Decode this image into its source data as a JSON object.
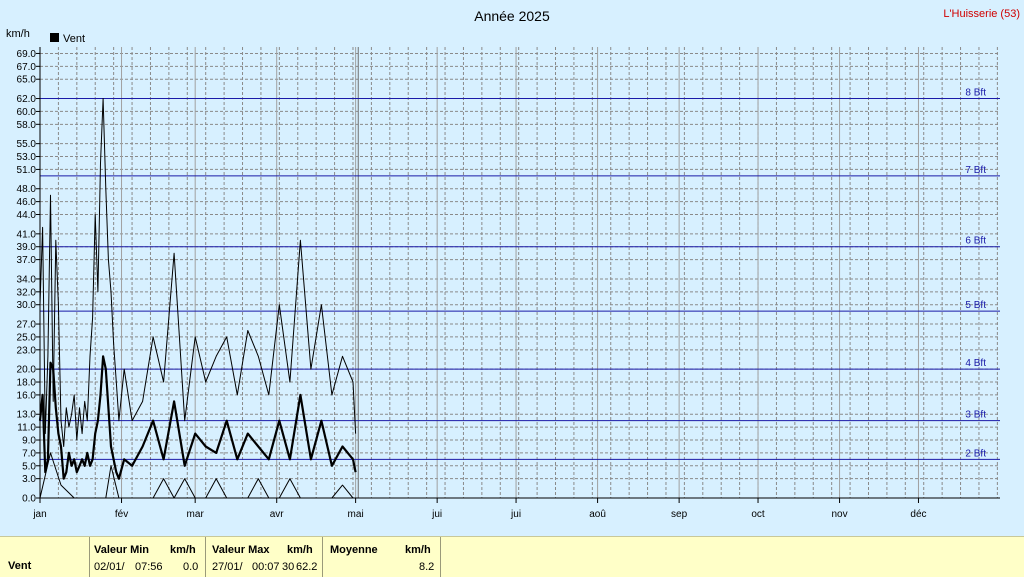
{
  "chart_data": {
    "type": "line",
    "title": "Année 2025",
    "station": "L'Huisserie (53)",
    "ylabel": "km/h",
    "ylim": [
      0,
      70
    ],
    "yticks": [
      "0.0",
      "3.0",
      "5.0",
      "7.0",
      "9.0",
      "11.0",
      "13.0",
      "16.0",
      "18.0",
      "20.0",
      "23.0",
      "25.0",
      "27.0",
      "30.0",
      "32.0",
      "34.0",
      "37.0",
      "39.0",
      "41.0",
      "44.0",
      "46.0",
      "48.0",
      "51.0",
      "53.0",
      "55.0",
      "58.0",
      "60.0",
      "62.0",
      "65.0",
      "67.0",
      "69.0"
    ],
    "months": [
      "jan",
      "fév",
      "mar",
      "avr",
      "mai",
      "jui",
      "jui",
      "aoû",
      "sep",
      "oct",
      "nov",
      "déc"
    ],
    "legend": [
      {
        "name": "Vent",
        "color": "#000000"
      }
    ],
    "grid": true,
    "beaufort": [
      {
        "label": "2 Bft",
        "value": 6
      },
      {
        "label": "3 Bft",
        "value": 12
      },
      {
        "label": "4 Bft",
        "value": 20
      },
      {
        "label": "5 Bft",
        "value": 29
      },
      {
        "label": "6 Bft",
        "value": 39
      },
      {
        "label": "7 Bft",
        "value": 50
      },
      {
        "label": "8 Bft",
        "value": 62
      }
    ],
    "series": [
      {
        "role": "max",
        "days": [
          1,
          2,
          3,
          4,
          5,
          6,
          7,
          8,
          9,
          10,
          11,
          12,
          13,
          14,
          15,
          16,
          17,
          18,
          19,
          20,
          21,
          22,
          23,
          24,
          25,
          26,
          27,
          28,
          29,
          30,
          31,
          33,
          36,
          40,
          44,
          48,
          52,
          56,
          60,
          64,
          68,
          72,
          76,
          80,
          84,
          88,
          92,
          96,
          100,
          104,
          108,
          112,
          116,
          120,
          121
        ],
        "values": [
          30,
          42,
          10,
          22,
          47,
          15,
          40,
          30,
          12,
          8,
          14,
          11,
          13,
          16,
          9,
          14,
          10,
          15,
          12,
          22,
          28,
          44,
          32,
          52,
          62,
          48,
          37,
          32,
          24,
          18,
          12,
          20,
          12,
          15,
          25,
          18,
          38,
          12,
          25,
          18,
          22,
          25,
          16,
          26,
          22,
          16,
          30,
          18,
          40,
          20,
          30,
          16,
          22,
          18,
          10
        ]
      },
      {
        "role": "avg",
        "days": [
          1,
          2,
          3,
          4,
          5,
          6,
          7,
          8,
          9,
          10,
          11,
          12,
          13,
          14,
          15,
          16,
          17,
          18,
          19,
          20,
          21,
          22,
          23,
          24,
          25,
          26,
          27,
          28,
          29,
          30,
          31,
          33,
          36,
          40,
          44,
          48,
          52,
          56,
          60,
          64,
          68,
          72,
          76,
          80,
          84,
          88,
          92,
          96,
          100,
          104,
          108,
          112,
          116,
          120,
          121
        ],
        "values": [
          12,
          16,
          4,
          6,
          21,
          20,
          14,
          10,
          8,
          3,
          4,
          7,
          5,
          6,
          4,
          5,
          6,
          5,
          7,
          5,
          6,
          10,
          12,
          16,
          22,
          20,
          14,
          8,
          6,
          4,
          3,
          6,
          5,
          8,
          12,
          6,
          15,
          5,
          10,
          8,
          7,
          12,
          6,
          10,
          8,
          6,
          12,
          6,
          16,
          6,
          12,
          5,
          8,
          6,
          4
        ]
      },
      {
        "role": "min",
        "days": [
          1,
          5,
          9,
          14,
          18,
          23,
          26,
          28,
          31,
          35,
          40,
          44,
          48,
          52,
          56,
          60,
          64,
          68,
          72,
          76,
          80,
          84,
          88,
          92,
          96,
          100,
          104,
          108,
          112,
          116,
          120,
          121
        ],
        "values": [
          0,
          7,
          2,
          0,
          0,
          0,
          0,
          5,
          0,
          0,
          0,
          0,
          3,
          0,
          3,
          0,
          0,
          3,
          0,
          0,
          0,
          3,
          0,
          0,
          3,
          0,
          0,
          0,
          0,
          2,
          0,
          0
        ]
      }
    ]
  },
  "footer": {
    "row_label": "Vent",
    "min": {
      "header": "Valeur Min",
      "unit": "km/h",
      "date": "02/01/",
      "time": "07:56",
      "value": "0.0"
    },
    "max": {
      "header": "Valeur Max",
      "unit": "km/h",
      "date": "27/01/",
      "time": "00:07",
      "time_tail": "30",
      "value": "62.2"
    },
    "avg": {
      "header": "Moyenne",
      "unit": "km/h",
      "value": "8.2"
    }
  }
}
